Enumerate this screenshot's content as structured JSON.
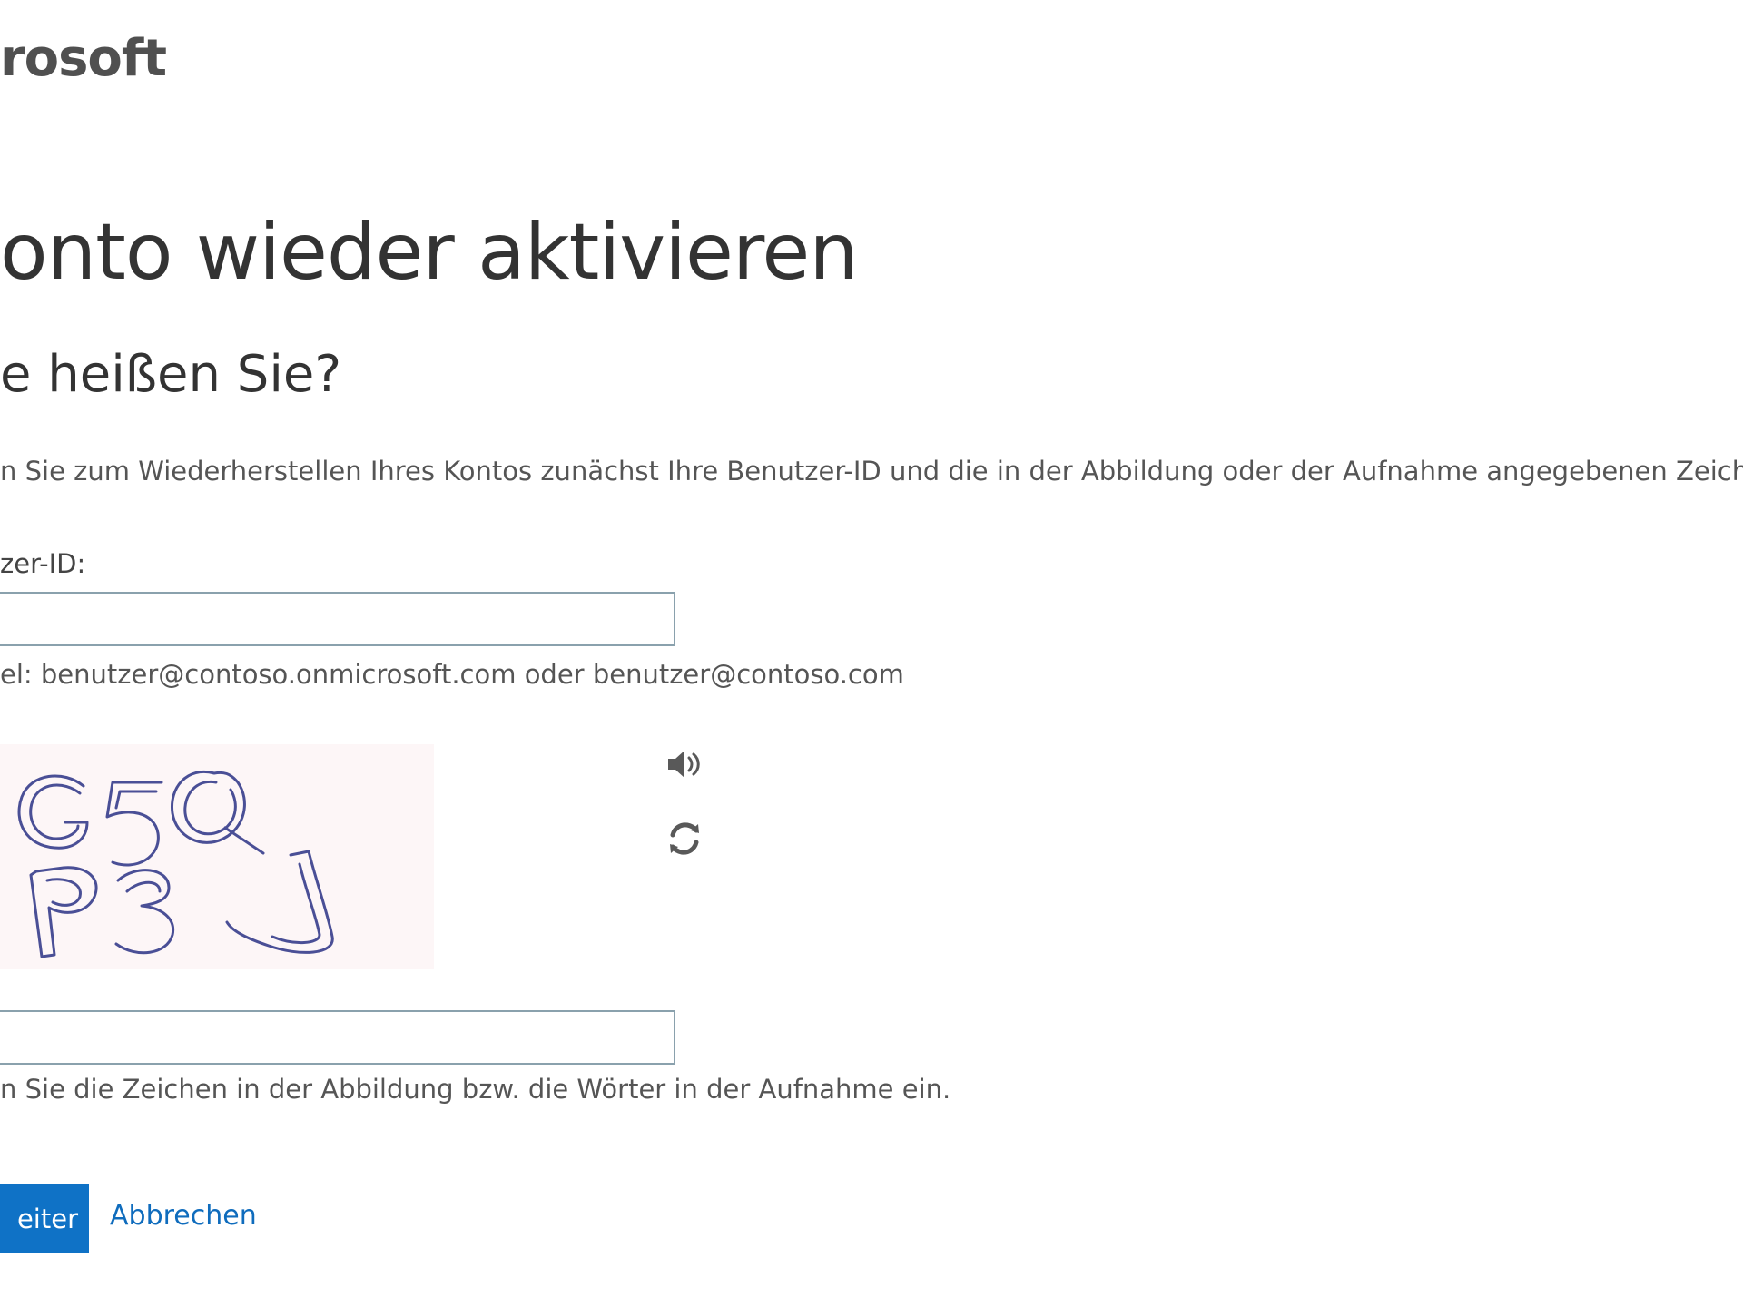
{
  "header": {
    "brand_text": "rosoft"
  },
  "main": {
    "title": "onto wieder aktivieren",
    "subtitle": "e heißen Sie?",
    "intro": "n Sie zum Wiederherstellen Ihres Kontos zunächst Ihre Benutzer-ID und die in der Abbildung oder der Aufnahme angegebenen Zeichen e",
    "userid": {
      "label": "zer-ID:",
      "value": "",
      "hint": "el: benutzer@contoso.onmicrosoft.com oder benutzer@contoso.com"
    },
    "captcha": {
      "image_text": "G5Q p3J",
      "audio_icon": "speaker-icon",
      "refresh_icon": "refresh-icon",
      "value": "",
      "hint": "n Sie die Zeichen in der Abbildung bzw. die Wörter in der Aufnahme ein."
    },
    "actions": {
      "next_label": "eiter",
      "cancel_label": "Abbrechen"
    }
  },
  "colors": {
    "primary_button": "#0f72c6",
    "link": "#0f6cbd",
    "input_border": "#8aa1ad",
    "captcha_background": "#fdf6f7",
    "captcha_ink": "#4a4f96"
  }
}
